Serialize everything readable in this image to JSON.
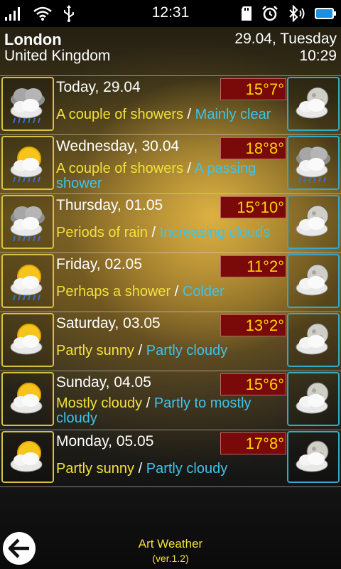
{
  "status_bar": {
    "time": "12:31",
    "icons": [
      "signal-icon",
      "wifi-icon",
      "usb-icon",
      "sd-card-icon",
      "alarm-icon",
      "bluetooth-icon",
      "battery-icon"
    ]
  },
  "header": {
    "city": "London",
    "country": "United Kingdom",
    "date": "29.04, Tuesday",
    "time": "10:29"
  },
  "forecast": [
    {
      "day": "Today, 29.04",
      "hi": "15",
      "lo": "7",
      "deg": "°",
      "desc_day": "A couple of showers",
      "sep": " / ",
      "desc_night": "Mainly clear",
      "day_icon": "showers-cloud-icon",
      "night_icon": "moon-cloud-icon"
    },
    {
      "day": "Wednesday, 30.04",
      "hi": "18",
      "lo": "8",
      "deg": "°",
      "desc_day": "A couple of showers",
      "sep": " / ",
      "desc_night": "A passing shower",
      "day_icon": "sun-showers-icon",
      "night_icon": "rain-cloud-icon"
    },
    {
      "day": "Thursday, 01.05",
      "hi": "15",
      "lo": "10",
      "deg": "°",
      "desc_day": "Periods of rain",
      "sep": " / ",
      "desc_night": "Increasing clouds",
      "day_icon": "rain-cloud-icon",
      "night_icon": "moon-cloud-icon"
    },
    {
      "day": "Friday, 02.05",
      "hi": "11",
      "lo": "2",
      "deg": "°",
      "desc_day": "Perhaps a shower",
      "sep": " / ",
      "desc_night": "Colder",
      "day_icon": "sun-cloud-shower-icon",
      "night_icon": "moon-cloud-icon"
    },
    {
      "day": "Saturday, 03.05",
      "hi": "13",
      "lo": "2",
      "deg": "°",
      "desc_day": "Partly sunny",
      "sep": " / ",
      "desc_night": "Partly cloudy",
      "day_icon": "sun-cloud-icon",
      "night_icon": "moon-cloud-icon"
    },
    {
      "day": "Sunday, 04.05",
      "hi": "15",
      "lo": "6",
      "deg": "°",
      "desc_day": "Mostly cloudy",
      "sep": " / ",
      "desc_night": "Partly to mostly cloudy",
      "day_icon": "sun-cloud-icon",
      "night_icon": "moon-cloud-icon"
    },
    {
      "day": "Monday, 05.05",
      "hi": "17",
      "lo": "8",
      "deg": "°",
      "desc_day": "Partly sunny",
      "sep": " / ",
      "desc_night": "Partly cloudy",
      "day_icon": "sun-cloud-icon",
      "night_icon": "moon-cloud-icon"
    }
  ],
  "footer": {
    "app_name": "Art Weather",
    "version": "(ver.1.2)",
    "back_icon": "back-arrow-icon"
  }
}
